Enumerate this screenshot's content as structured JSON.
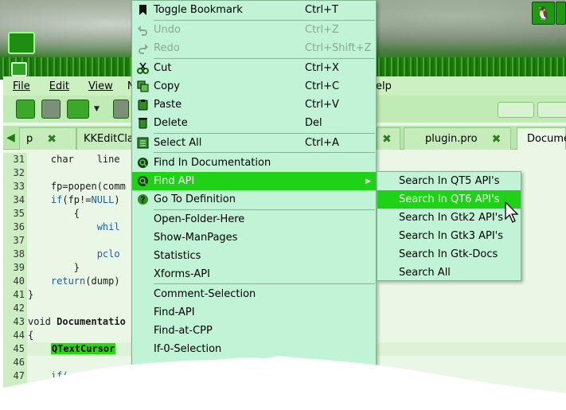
{
  "menubar": {
    "items": [
      {
        "label": "File"
      },
      {
        "label": "Edit"
      },
      {
        "label": "View"
      },
      {
        "label": "Navig"
      },
      {
        "label": "elp"
      }
    ]
  },
  "tabs": [
    {
      "label": "p",
      "closable": true
    },
    {
      "label": "KKEditCla",
      "closable": false
    },
    {
      "label": "plugin.pro",
      "closable": true
    },
    {
      "label": "Docume",
      "closable": false,
      "active": true
    }
  ],
  "line_numbers": [
    "31",
    "32",
    "33",
    "34",
    "35",
    "36",
    "37",
    "38",
    "39",
    "40",
    "41",
    "42",
    "43",
    "44",
    "45",
    "46",
    "47"
  ],
  "code": {
    "l31": "    char    line",
    "l32": "",
    "l33a": "    fp=popen(comm",
    "l34a": "    ",
    "l34kw": "if",
    "l34b": "(fp!=",
    "l34null": "NULL",
    "l34c": ") ",
    "l35": "        {",
    "l36a": "            ",
    "l36kw": "whil",
    "l37": "",
    "l38a": "            ",
    "l38b": "pclo",
    "l39": "        }",
    "l40a": "    ",
    "l40kw": "return",
    "l40b": "(dump)",
    "l41": "}",
    "l42": "",
    "l43a": "void ",
    "l43b": "Documentatio",
    "l44": "{",
    "l45pre": "    ",
    "l45sel": "QTextCursor",
    "l46": "",
    "l47a": "    ",
    "l47kw": "if("
  },
  "context_menu": {
    "items": [
      {
        "label": "Toggle Bookmark",
        "shortcut": "Ctrl+T",
        "icon": "bookmark-icon"
      },
      {
        "label": "Undo",
        "shortcut": "Ctrl+Z",
        "icon": "undo-icon",
        "disabled": true
      },
      {
        "label": "Redo",
        "shortcut": "Ctrl+Shift+Z",
        "icon": "redo-icon",
        "disabled": true
      },
      {
        "label": "Cut",
        "shortcut": "Ctrl+X",
        "icon": "scissors-icon"
      },
      {
        "label": "Copy",
        "shortcut": "Ctrl+C",
        "icon": "copy-icon"
      },
      {
        "label": "Paste",
        "shortcut": "Ctrl+V",
        "icon": "paste-icon"
      },
      {
        "label": "Delete",
        "shortcut": "Del",
        "icon": "trash-icon"
      },
      {
        "label": "Select All",
        "shortcut": "Ctrl+A",
        "icon": "select-all-icon"
      },
      {
        "label": "Find In Documentation",
        "shortcut": "",
        "icon": "search-doc-icon"
      },
      {
        "label": "Find API",
        "shortcut": "",
        "icon": "search-api-icon",
        "active": true,
        "has_submenu": true
      },
      {
        "label": "Go To Definition",
        "shortcut": "",
        "icon": "question-icon"
      },
      {
        "label": "Open-Folder-Here",
        "shortcut": ""
      },
      {
        "label": "Show-ManPages",
        "shortcut": ""
      },
      {
        "label": "Statistics",
        "shortcut": ""
      },
      {
        "label": "Xforms-API",
        "shortcut": ""
      },
      {
        "label": "Comment-Selection",
        "shortcut": ""
      },
      {
        "label": "Find-API",
        "shortcut": ""
      },
      {
        "label": "Find-at-CPP",
        "shortcut": ""
      },
      {
        "label": "If-0-Selection",
        "shortcut": ""
      }
    ]
  },
  "submenu": {
    "items": [
      {
        "label": "Search In QT5 API's"
      },
      {
        "label": "Search In QT6 API's",
        "active": true
      },
      {
        "label": "Search In Gtk2 API's"
      },
      {
        "label": "Search In Gtk3 API's"
      },
      {
        "label": "Search In Gtk-Docs"
      },
      {
        "label": "Search All"
      }
    ]
  },
  "colors": {
    "menu_bg": "#c1f3d6",
    "highlight": "#1fd117",
    "selection": "#2bd612",
    "keyword": "#1d5f9a"
  }
}
